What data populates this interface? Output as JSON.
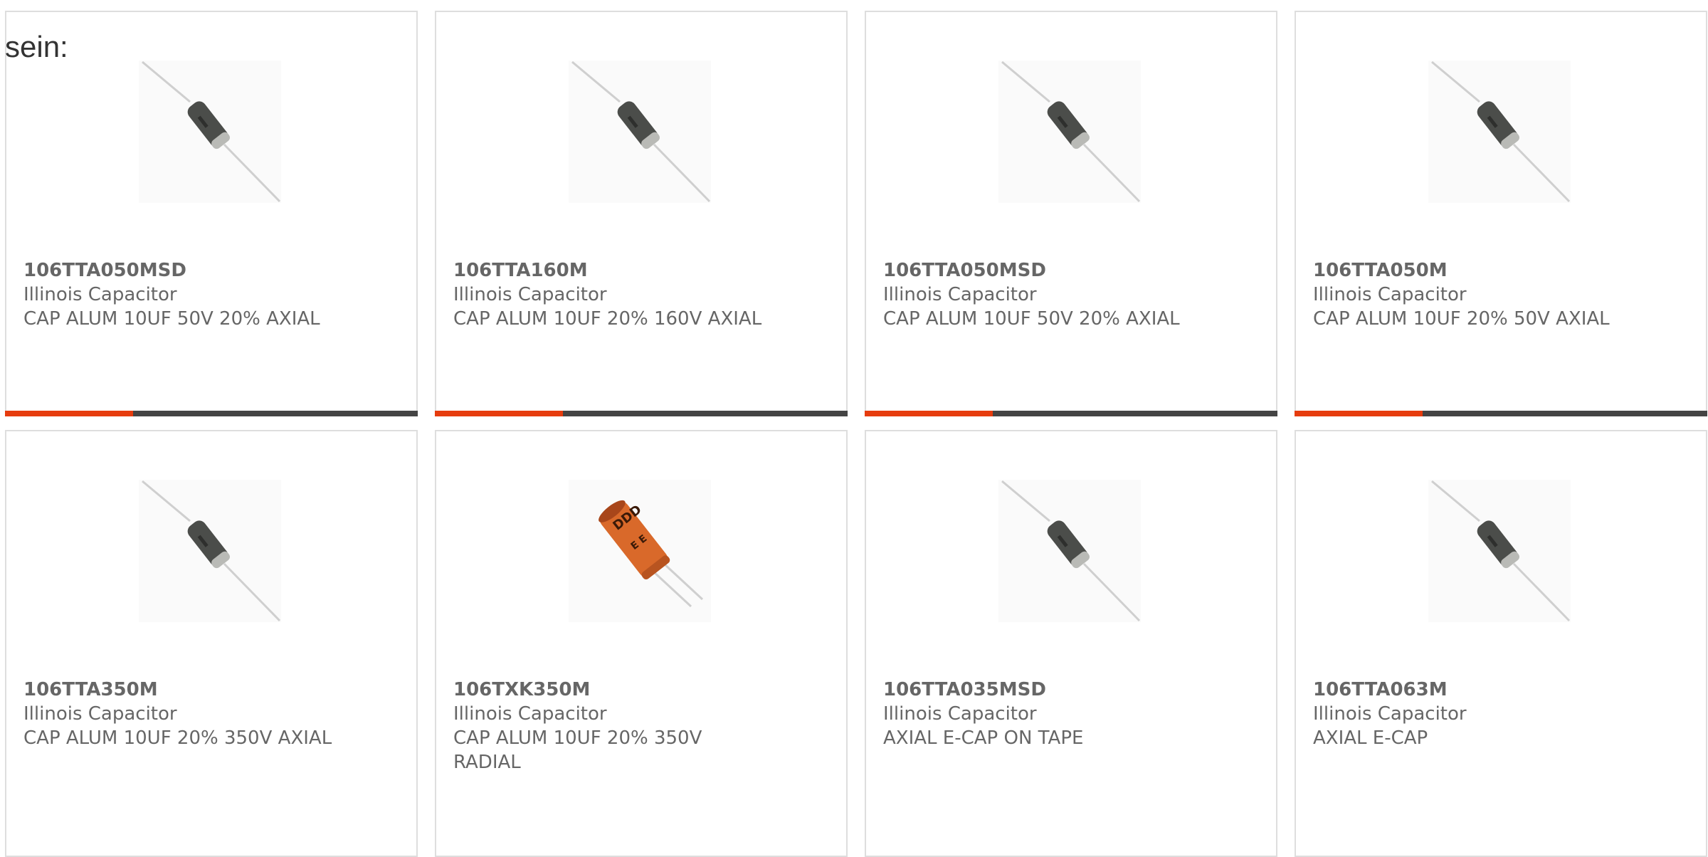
{
  "page": {
    "prefix_text": "sein:"
  },
  "colors": {
    "accent": "#e63c0e",
    "bar_track": "#444444",
    "border": "#dedede",
    "text": "#666666"
  },
  "products": [
    {
      "part_number": "106TTA050MSD",
      "manufacturer": "Illinois Capacitor",
      "description": "CAP ALUM 10UF 50V 20% AXIAL",
      "image_icon": "axial-capacitor-icon",
      "progress": 0.31
    },
    {
      "part_number": "106TTA160M",
      "manufacturer": "Illinois Capacitor",
      "description": "CAP ALUM 10UF 20% 160V AXIAL",
      "image_icon": "axial-capacitor-icon",
      "progress": 0.31
    },
    {
      "part_number": "106TTA050MSD",
      "manufacturer": "Illinois Capacitor",
      "description": "CAP ALUM 10UF 50V 20% AXIAL",
      "image_icon": "axial-capacitor-icon",
      "progress": 0.31
    },
    {
      "part_number": "106TTA050M",
      "manufacturer": "Illinois Capacitor",
      "description": "CAP ALUM 10UF 20% 50V AXIAL",
      "image_icon": "axial-capacitor-icon",
      "progress": 0.31
    },
    {
      "part_number": "106TTA350M",
      "manufacturer": "Illinois Capacitor",
      "description": "CAP ALUM 10UF 20% 350V AXIAL",
      "image_icon": "axial-capacitor-icon"
    },
    {
      "part_number": "106TXK350M",
      "manufacturer": "Illinois Capacitor",
      "description": "CAP ALUM 10UF 20% 350V RADIAL",
      "image_icon": "radial-capacitor-icon"
    },
    {
      "part_number": "106TTA035MSD",
      "manufacturer": "Illinois Capacitor",
      "description": "AXIAL E-CAP ON TAPE",
      "image_icon": "axial-capacitor-icon"
    },
    {
      "part_number": "106TTA063M",
      "manufacturer": "Illinois Capacitor",
      "description": "AXIAL E-CAP",
      "image_icon": "axial-capacitor-icon"
    }
  ]
}
